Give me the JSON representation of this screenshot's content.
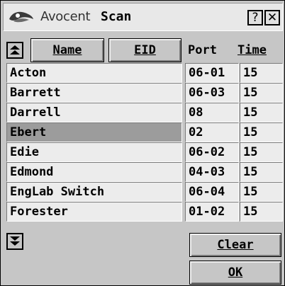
{
  "titlebar": {
    "brand": "Avocent",
    "title": "Scan",
    "help_label": "?",
    "close_label": "✕"
  },
  "header": {
    "name_label": "Name",
    "eid_label": "EID",
    "port_label": "Port",
    "time_label": "Time"
  },
  "rows": [
    {
      "name": "Acton",
      "port": "06-01",
      "time": "15"
    },
    {
      "name": "Barrett",
      "port": "06-03",
      "time": "15"
    },
    {
      "name": "Darrell",
      "port": "08",
      "time": "15"
    },
    {
      "name": "Ebert",
      "port": "02",
      "time": "15"
    },
    {
      "name": "Edie",
      "port": "06-02",
      "time": "15"
    },
    {
      "name": "Edmond",
      "port": "04-03",
      "time": "15"
    },
    {
      "name": "EngLab Switch",
      "port": "06-04",
      "time": "15"
    },
    {
      "name": "Forester",
      "port": "01-02",
      "time": "15"
    }
  ],
  "buttons": {
    "clear_label": "Clear",
    "ok_label": "OK"
  }
}
